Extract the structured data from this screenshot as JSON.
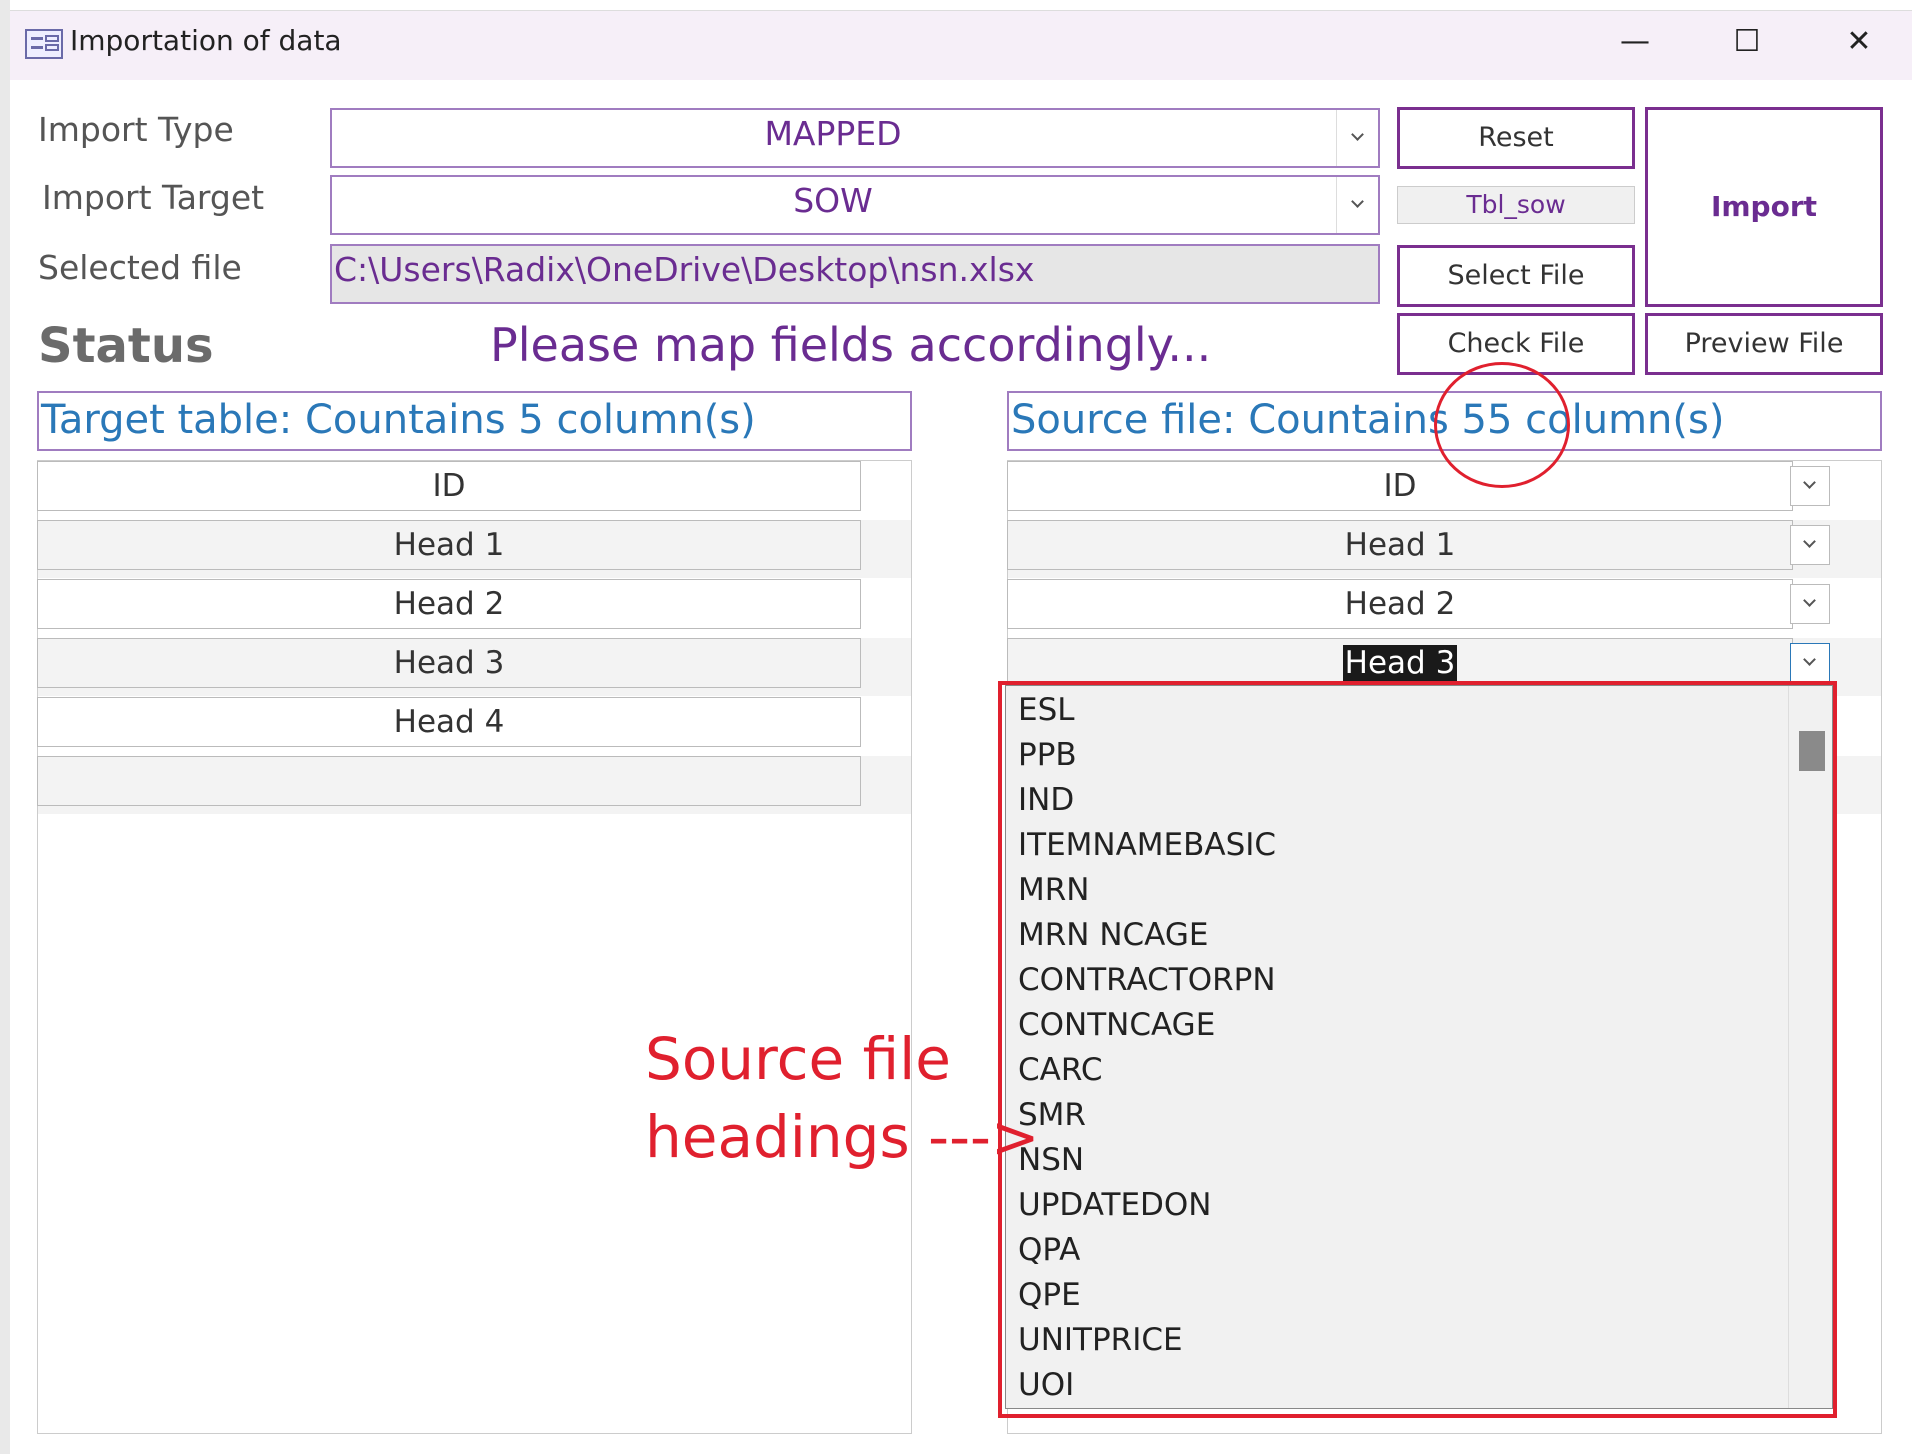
{
  "window": {
    "title": "Importation of data",
    "minimize": "—",
    "maximize": "☐",
    "close": "✕"
  },
  "form": {
    "import_type": {
      "label": "Import Type",
      "value": "MAPPED"
    },
    "import_target": {
      "label": "Import Target",
      "value": "SOW"
    },
    "selected_file": {
      "label": "Selected file",
      "value": "C:\\Users\\Radix\\OneDrive\\Desktop\\nsn.xlsx"
    },
    "table_name": "Tbl_sow"
  },
  "buttons": {
    "reset": "Reset",
    "select_file": "Select File",
    "check_file": "Check File",
    "preview_file": "Preview File",
    "import": "Import"
  },
  "status": {
    "label": "Status",
    "message": "Please map fields accordingly..."
  },
  "target_table": {
    "header": "Target table: Countains 5 column(s)",
    "rows": [
      "ID",
      "Head 1",
      "Head 2",
      "Head 3",
      "Head 4",
      ""
    ]
  },
  "source_file": {
    "header": "Source file: Countains 55 column(s)",
    "rows": [
      "ID",
      "Head 1",
      "Head 2",
      "Head 3"
    ],
    "dropdown_options": [
      "ESL",
      "PPB",
      "IND",
      "ITEMNAMEBASIC",
      "MRN",
      "MRN NCAGE",
      "CONTRACTORPN",
      "CONTNCAGE",
      "CARC",
      "SMR",
      "NSN",
      "UPDATEDON",
      "QPA",
      "QPE",
      "UNITPRICE",
      "UOI"
    ]
  },
  "annotation": {
    "text": "Source file\nheadings --->"
  },
  "colors": {
    "accent": "#7a2f8f",
    "text_purple": "#6a2c91",
    "header_blue": "#2a78b8",
    "annotation_red": "#e0202e"
  }
}
